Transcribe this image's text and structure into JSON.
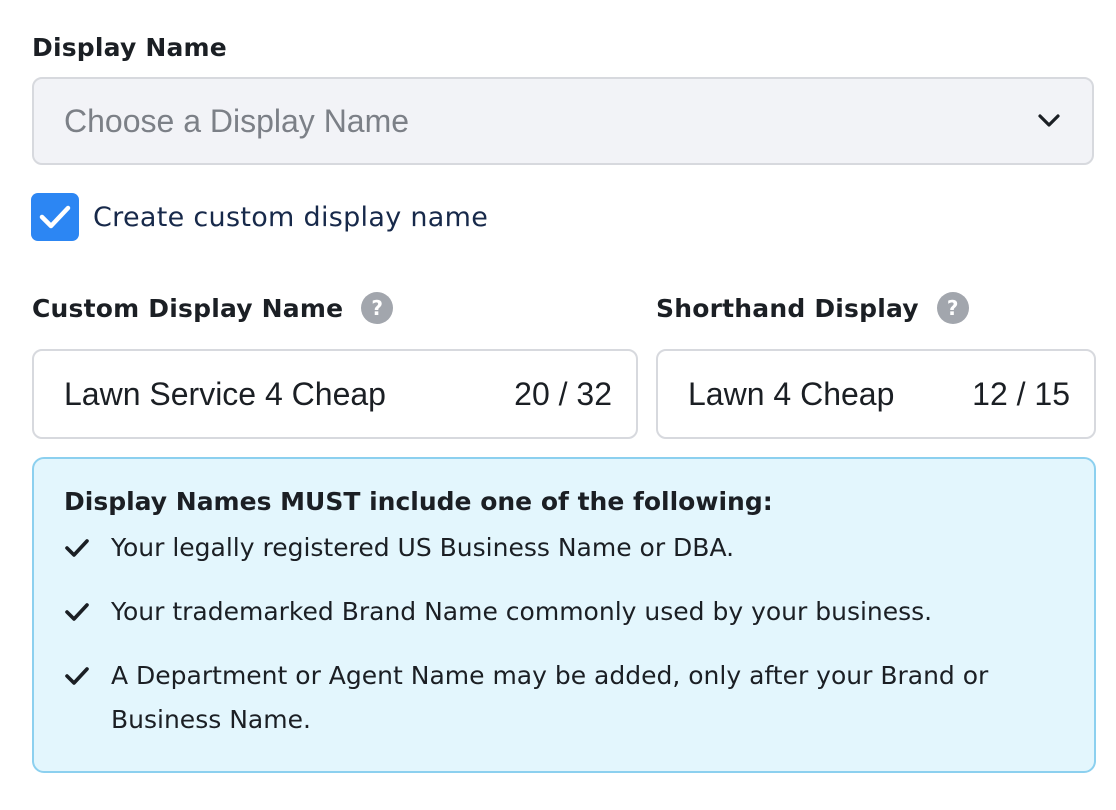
{
  "display_name": {
    "label": "Display Name",
    "placeholder": "Choose a Display Name"
  },
  "custom_checkbox": {
    "label": "Create custom display name",
    "checked": true
  },
  "custom_display_name": {
    "label": "Custom Display Name",
    "help": "?",
    "value": "Lawn Service 4 Cheap",
    "count": "20 / 32"
  },
  "shorthand_display": {
    "label": "Shorthand Display",
    "help": "?",
    "value": "Lawn 4 Cheap",
    "count": "12 / 15"
  },
  "info": {
    "title": "Display Names MUST include one of the following:",
    "items": [
      "Your legally registered US Business Name or DBA.",
      "Your trademarked Brand Name commonly used by your business.",
      "A Department or Agent Name may be added, only after your Brand or Business Name."
    ]
  },
  "colors": {
    "checkbox_blue": "#2c86f3",
    "info_bg": "#e3f6fd",
    "info_border": "#8cd0ef",
    "help_icon_gray": "#a2a6ad"
  }
}
